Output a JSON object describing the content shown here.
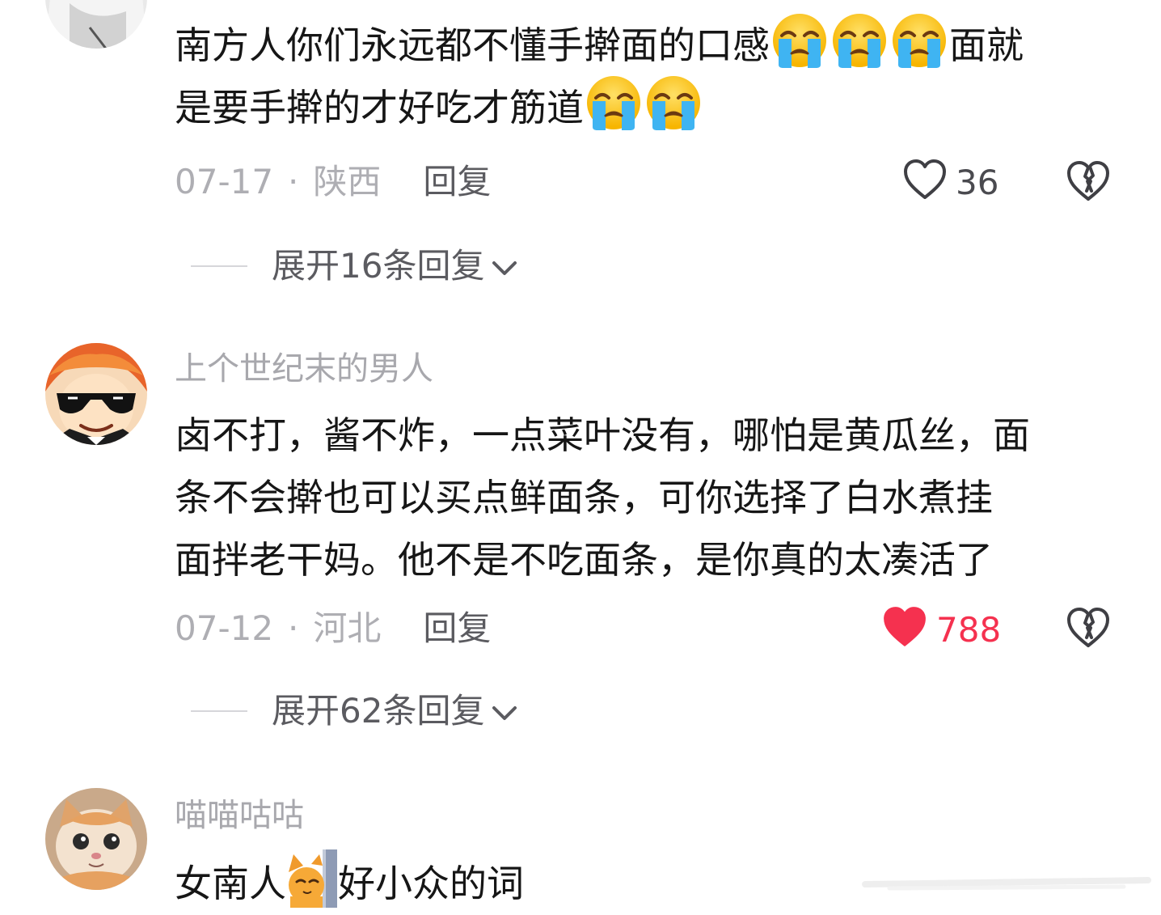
{
  "comments": [
    {
      "username": "",
      "lines": [
        {
          "segments": [
            {
              "t": "南方人你们永远都不懂手擀面的口感"
            },
            {
              "e": "crying-face"
            },
            {
              "e": "crying-face"
            },
            {
              "e": "crying-face"
            },
            {
              "t": "面就"
            }
          ]
        },
        {
          "segments": [
            {
              "t": "是要手擀的才好吃才筋道"
            },
            {
              "e": "crying-face"
            },
            {
              "e": "crying-face"
            }
          ]
        }
      ],
      "date": "07-17",
      "separator": "·",
      "location": "陕西",
      "reply_label": "回复",
      "likes": "36",
      "liked": false,
      "expand_label": "展开16条回复"
    },
    {
      "username": "上个世纪末的男人",
      "lines": [
        {
          "segments": [
            {
              "t": "卤不打，酱不炸，一点菜叶没有，哪怕是黄瓜丝，面"
            }
          ]
        },
        {
          "segments": [
            {
              "t": "条不会擀也可以买点鲜面条，可你选择了白水煮挂"
            }
          ]
        },
        {
          "segments": [
            {
              "t": "面拌老干妈。他不是不吃面条，是你真的太凑活了"
            }
          ]
        }
      ],
      "date": "07-12",
      "separator": "·",
      "location": "河北",
      "reply_label": "回复",
      "likes": "788",
      "liked": true,
      "expand_label": "展开62条回复"
    },
    {
      "username": "喵喵咕咕",
      "lines": [
        {
          "segments": [
            {
              "t": "女南人"
            },
            {
              "e": "cat-peeking"
            },
            {
              "t": "好小众的词"
            }
          ]
        }
      ]
    }
  ],
  "icons": {
    "like": "heart-outline-icon",
    "liked": "heart-filled-icon",
    "dislike": "broken-heart-icon",
    "expand": "chevron-down-icon"
  },
  "colors": {
    "like_active": "#f5314f",
    "secondary_text": "#aeaeb3",
    "primary_text": "#161616"
  }
}
